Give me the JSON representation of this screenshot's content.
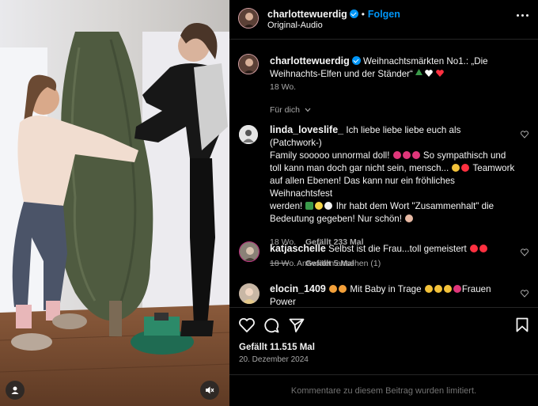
{
  "post": {
    "username": "charlottewuerdig",
    "follow_label": "Folgen",
    "audio_label": "Original-Audio",
    "caption": "Weihnachtsmärkten No1.: „Die Weihnachts-Elfen und der Ständer“",
    "caption_age": "18 Wo.",
    "sort_label": "Für dich",
    "likes_label": "Gefällt 11.515 Mal",
    "date_label": "20. Dezember 2024",
    "comments_limited": "Kommentare zu diesem Beitrag wurden limitiert."
  },
  "comments": [
    {
      "username": "linda_loveslife_",
      "lines": [
        "Ich liebe liebe liebe euch als (Patchwork-)",
        "Family sooooo unnormal doll!",
        "So sympathisch und",
        "toll kann man doch gar nicht sein, mensch...",
        "Teamwork",
        "auf allen Ebenen! Das kann nur ein fröhliches Weihnachtsfest",
        "werden!",
        "Ihr habt dem Wort \"Zusammenhalt\" die",
        "Bedeutung gegeben! Nur schön!"
      ],
      "age": "18 Wo.",
      "likes": "Gefällt 233 Mal",
      "replies": "Antworten ansehen (1)"
    },
    {
      "username": "katjaschelle",
      "text": "Selbst ist die Frau...toll gemeistert",
      "age": "18 Wo.",
      "likes": "Gefällt 5 Mal"
    },
    {
      "username": "elocin_1409",
      "text_a": "Mit Baby in Trage",
      "text_b": "Frauen Power"
    }
  ],
  "colors": {
    "accent": "#0095f6",
    "background": "#000000",
    "divider": "#262626",
    "secondary_text": "#a8a8a8",
    "like_red": "#ff3040"
  },
  "icons": [
    "more-options-icon",
    "heart-icon",
    "comment-icon",
    "share-icon",
    "bookmark-icon",
    "user-tag-icon",
    "mute-icon",
    "chevron-down-icon",
    "verified-badge-icon"
  ]
}
